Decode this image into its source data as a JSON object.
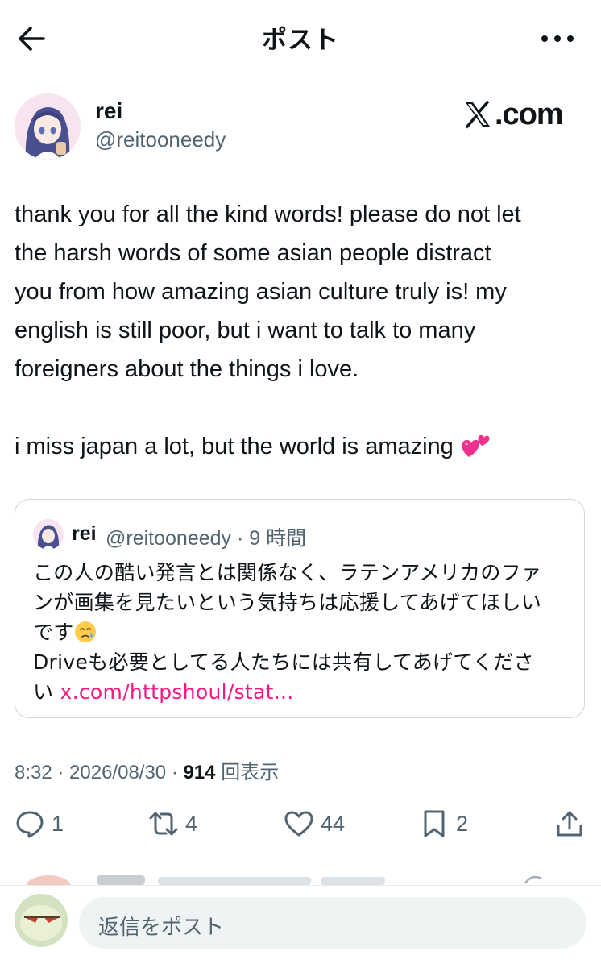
{
  "header": {
    "title": "ポスト",
    "back_icon": "arrow-left-icon",
    "more_icon": "more-dots-icon"
  },
  "author": {
    "name": "rei",
    "handle": "@reitooneedy",
    "logo_text": ".com"
  },
  "post": {
    "text": "thank you for all the kind words! please do not let\nthe harsh words of some asian people distract\nyou from how amazing asian culture truly is! my\nenglish is still poor, but i want to talk to many\nforeigners about the things i love.\n\ni miss japan a lot, but the world is amazing "
  },
  "quote": {
    "name": "rei",
    "meta": "@reitooneedy · 9 時間",
    "text": "この人の酷い発言とは関係なく、ラテンアメリカのファ\nンが画集を見たいという気持ちは応援してあげてほしい\nです",
    "text2": "\nDriveも必要としてる人たちには共有してあげてくださ\nい ",
    "link": "x.com/httpshoul/stat..."
  },
  "meta": {
    "time": "8:32 · 2026/08/30 · ",
    "views": "914",
    "views_label": " 回表示"
  },
  "actions": {
    "replies": "1",
    "reposts": "4",
    "likes": "44",
    "bookmarks": "2"
  },
  "reply_bar": {
    "placeholder": "返信をポスト"
  },
  "colors": {
    "accent": "#f91880",
    "secondary_text": "#536471",
    "border": "#cfd9de"
  }
}
